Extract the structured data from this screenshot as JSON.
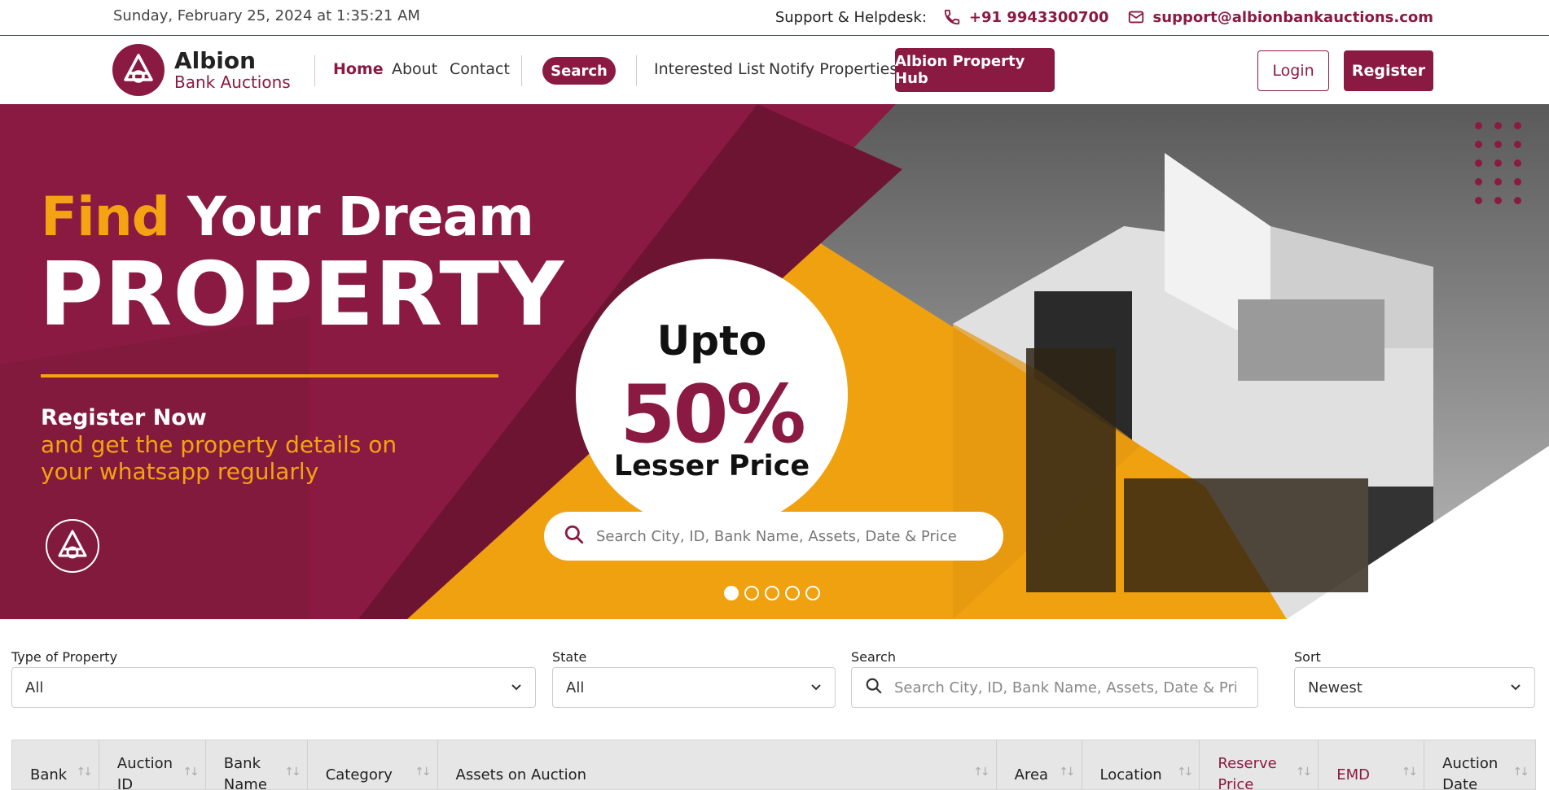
{
  "topbar": {
    "datetime": "Sunday, February 25, 2024 at 1:35:21 AM",
    "support_label": "Support & Helpdesk:",
    "phone": "+91 9943300700",
    "email": "support@albionbankauctions.com"
  },
  "brand": {
    "name": "Albion",
    "tagline": "Bank Auctions",
    "primary_color": "#8b1a42",
    "accent_color": "#f5a312"
  },
  "nav": {
    "home": "Home",
    "about": "About",
    "contact": "Contact",
    "search": "Search",
    "interested": "Interested List",
    "notify": "Notify Properties",
    "hub": "Albion Property Hub",
    "login": "Login",
    "register": "Register"
  },
  "hero": {
    "find": "Find",
    "your_dream": "Your Dream",
    "property": "PROPERTY",
    "register_now": "Register Now",
    "register_sub": "and get the property details on your whatsapp regularly",
    "upto": "Upto",
    "percent": "50%",
    "lesser_price": "Lesser Price",
    "search_placeholder": "Search City, ID, Bank Name, Assets, Date & Price",
    "slides_total": 5,
    "active_slide": 1
  },
  "filters": {
    "type_label": "Type of Property",
    "type_value": "All",
    "state_label": "State",
    "state_value": "All",
    "search_label": "Search",
    "search_placeholder": "Search City, ID, Bank Name, Assets, Date & Price",
    "sort_label": "Sort",
    "sort_value": "Newest"
  },
  "table": {
    "columns": [
      {
        "label": "Bank",
        "highlight": false
      },
      {
        "label": "Auction ID",
        "highlight": false
      },
      {
        "label": "Bank Name",
        "highlight": false
      },
      {
        "label": "Category",
        "highlight": false
      },
      {
        "label": "Assets on Auction",
        "highlight": false
      },
      {
        "label": "Area",
        "highlight": false
      },
      {
        "label": "Location",
        "highlight": false
      },
      {
        "label": "Reserve Price",
        "highlight": true
      },
      {
        "label": "EMD",
        "highlight": true
      },
      {
        "label": "Auction Date",
        "highlight": false
      }
    ]
  }
}
